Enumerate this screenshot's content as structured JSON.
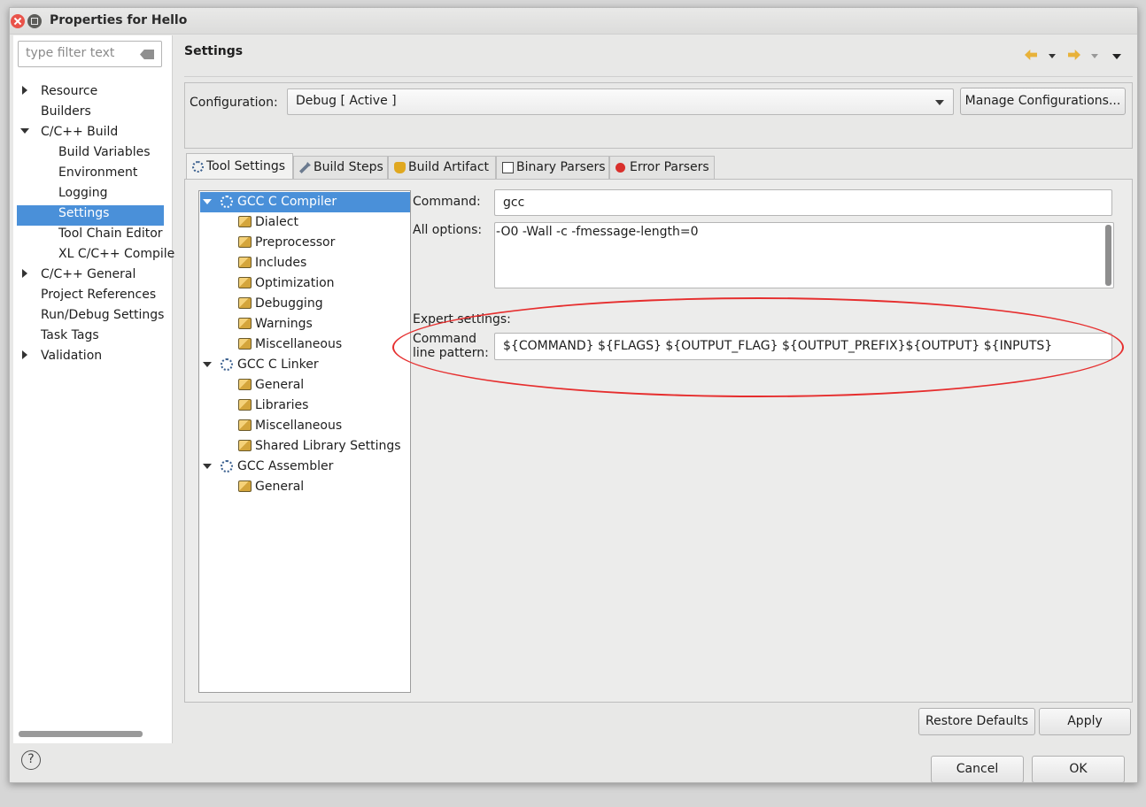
{
  "window": {
    "title": "Properties for Hello"
  },
  "nav": {
    "filter_placeholder": "type filter text",
    "items": [
      {
        "label": "Resource"
      },
      {
        "label": "Builders"
      },
      {
        "label": "C/C++ Build"
      },
      {
        "label": "Build Variables"
      },
      {
        "label": "Environment"
      },
      {
        "label": "Logging"
      },
      {
        "label": "Settings"
      },
      {
        "label": "Tool Chain Editor"
      },
      {
        "label": "XL C/C++ Compile"
      },
      {
        "label": "C/C++ General"
      },
      {
        "label": "Project References"
      },
      {
        "label": "Run/Debug Settings"
      },
      {
        "label": "Task Tags"
      },
      {
        "label": "Validation"
      }
    ]
  },
  "page": {
    "title": "Settings"
  },
  "config": {
    "label": "Configuration:",
    "value": "Debug  [ Active ]",
    "manage_label": "Manage Configurations..."
  },
  "tabs": [
    {
      "label": "Tool Settings",
      "icon": "tool-settings-icon"
    },
    {
      "label": "Build Steps",
      "icon": "build-steps-icon"
    },
    {
      "label": "Build Artifact",
      "icon": "build-artifact-icon"
    },
    {
      "label": "Binary Parsers",
      "icon": "binary-parsers-icon"
    },
    {
      "label": "Error Parsers",
      "icon": "error-parsers-icon"
    }
  ],
  "tree": {
    "items": [
      {
        "label": "GCC C Compiler"
      },
      {
        "label": "Dialect"
      },
      {
        "label": "Preprocessor"
      },
      {
        "label": "Includes"
      },
      {
        "label": "Optimization"
      },
      {
        "label": "Debugging"
      },
      {
        "label": "Warnings"
      },
      {
        "label": "Miscellaneous"
      },
      {
        "label": "GCC C Linker"
      },
      {
        "label": "General"
      },
      {
        "label": "Libraries"
      },
      {
        "label": "Miscellaneous"
      },
      {
        "label": "Shared Library Settings"
      },
      {
        "label": "GCC Assembler"
      },
      {
        "label": "General"
      }
    ]
  },
  "tool": {
    "command_label": "Command:",
    "command_value": "gcc",
    "all_options_label": "All options:",
    "all_options_value": "-O0 -Wall -c -fmessage-length=0",
    "expert_label": "Expert settings:",
    "pattern_label_1": "Command",
    "pattern_label_2": "line pattern:",
    "pattern_value": "${COMMAND} ${FLAGS} ${OUTPUT_FLAG} ${OUTPUT_PREFIX}${OUTPUT} ${INPUTS}"
  },
  "buttons": {
    "restore_defaults": "Restore Defaults",
    "apply": "Apply",
    "cancel": "Cancel",
    "ok": "OK",
    "help": "?"
  },
  "colors": {
    "selection": "#4a90d9",
    "annotation": "#e62e2e"
  }
}
